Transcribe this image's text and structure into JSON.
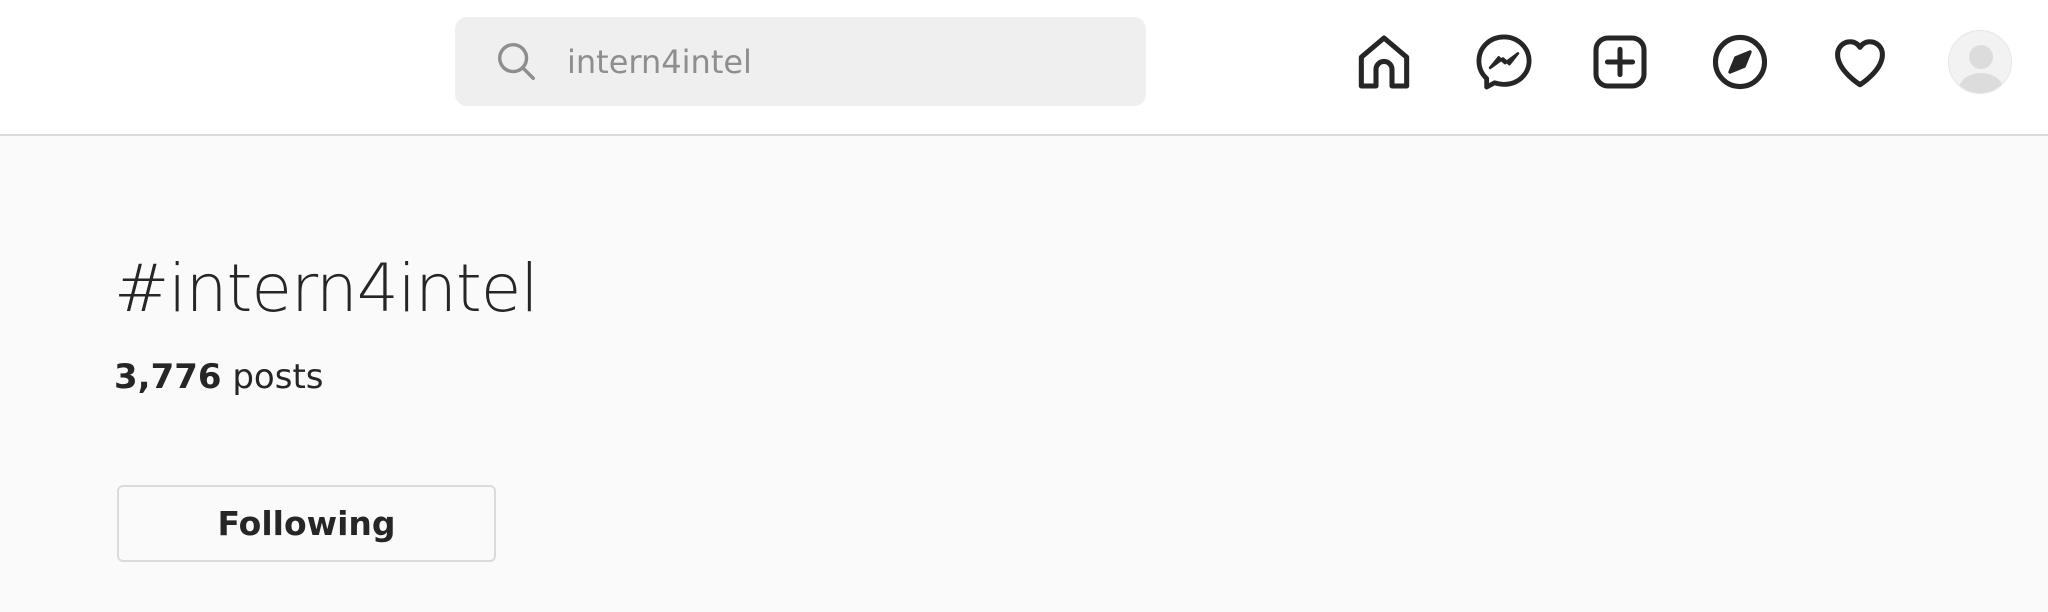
{
  "header": {
    "search": {
      "value": "intern4intel",
      "icon": "search-icon"
    },
    "nav_icons": [
      "home-icon",
      "messenger-icon",
      "new-post-icon",
      "explore-icon",
      "activity-heart-icon",
      "profile-avatar"
    ]
  },
  "hashtag": {
    "title": "#intern4intel",
    "post_count": "3,776",
    "post_count_suffix": " posts",
    "follow_button_label": "Following"
  }
}
